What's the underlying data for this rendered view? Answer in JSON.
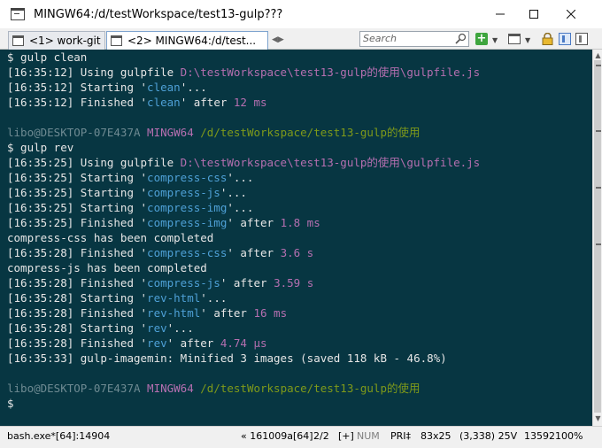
{
  "window": {
    "title": "MINGW64:/d/testWorkspace/test13-gulp???"
  },
  "tabs": [
    {
      "label": "<1> work-git"
    },
    {
      "label": "<2>  MINGW64:/d/test..."
    }
  ],
  "search": {
    "placeholder": "Search"
  },
  "toolbar": {
    "add_label": "+"
  },
  "console": {
    "lines": [
      [
        {
          "t": "$ gulp clean",
          "c": "w"
        }
      ],
      [
        {
          "t": "[16:35:12] Using gulpfile ",
          "c": "w"
        },
        {
          "t": "D:\\testWorkspace\\test13-gulp的使用\\gulpfile.js",
          "c": "p"
        }
      ],
      [
        {
          "t": "[16:35:12] Starting '",
          "c": "w"
        },
        {
          "t": "clean",
          "c": "b"
        },
        {
          "t": "'...",
          "c": "w"
        }
      ],
      [
        {
          "t": "[16:35:12] Finished '",
          "c": "w"
        },
        {
          "t": "clean",
          "c": "b"
        },
        {
          "t": "' after ",
          "c": "w"
        },
        {
          "t": "12 ms",
          "c": "p"
        }
      ],
      [],
      [
        {
          "t": "libo@DESKTOP-07E437A ",
          "c": "gr"
        },
        {
          "t": "MINGW64 ",
          "c": "p"
        },
        {
          "t": "/d/testWorkspace/test13-gulp的使用",
          "c": "g"
        }
      ],
      [
        {
          "t": "$ gulp rev",
          "c": "w"
        }
      ],
      [
        {
          "t": "[16:35:25] Using gulpfile ",
          "c": "w"
        },
        {
          "t": "D:\\testWorkspace\\test13-gulp的使用\\gulpfile.js",
          "c": "p"
        }
      ],
      [
        {
          "t": "[16:35:25] Starting '",
          "c": "w"
        },
        {
          "t": "compress-css",
          "c": "b"
        },
        {
          "t": "'...",
          "c": "w"
        }
      ],
      [
        {
          "t": "[16:35:25] Starting '",
          "c": "w"
        },
        {
          "t": "compress-js",
          "c": "b"
        },
        {
          "t": "'...",
          "c": "w"
        }
      ],
      [
        {
          "t": "[16:35:25] Starting '",
          "c": "w"
        },
        {
          "t": "compress-img",
          "c": "b"
        },
        {
          "t": "'...",
          "c": "w"
        }
      ],
      [
        {
          "t": "[16:35:25] Finished '",
          "c": "w"
        },
        {
          "t": "compress-img",
          "c": "b"
        },
        {
          "t": "' after ",
          "c": "w"
        },
        {
          "t": "1.8 ms",
          "c": "p"
        }
      ],
      [
        {
          "t": "compress-css has been completed",
          "c": "w"
        }
      ],
      [
        {
          "t": "[16:35:28] Finished '",
          "c": "w"
        },
        {
          "t": "compress-css",
          "c": "b"
        },
        {
          "t": "' after ",
          "c": "w"
        },
        {
          "t": "3.6 s",
          "c": "p"
        }
      ],
      [
        {
          "t": "compress-js has been completed",
          "c": "w"
        }
      ],
      [
        {
          "t": "[16:35:28] Finished '",
          "c": "w"
        },
        {
          "t": "compress-js",
          "c": "b"
        },
        {
          "t": "' after ",
          "c": "w"
        },
        {
          "t": "3.59 s",
          "c": "p"
        }
      ],
      [
        {
          "t": "[16:35:28] Starting '",
          "c": "w"
        },
        {
          "t": "rev-html",
          "c": "b"
        },
        {
          "t": "'...",
          "c": "w"
        }
      ],
      [
        {
          "t": "[16:35:28] Finished '",
          "c": "w"
        },
        {
          "t": "rev-html",
          "c": "b"
        },
        {
          "t": "' after ",
          "c": "w"
        },
        {
          "t": "16 ms",
          "c": "p"
        }
      ],
      [
        {
          "t": "[16:35:28] Starting '",
          "c": "w"
        },
        {
          "t": "rev",
          "c": "b"
        },
        {
          "t": "'...",
          "c": "w"
        }
      ],
      [
        {
          "t": "[16:35:28] Finished '",
          "c": "w"
        },
        {
          "t": "rev",
          "c": "b"
        },
        {
          "t": "' after ",
          "c": "w"
        },
        {
          "t": "4.74 μs",
          "c": "p"
        }
      ],
      [
        {
          "t": "[16:35:33] gulp-imagemin: Minified 3 images ",
          "c": "w"
        },
        {
          "t": "(saved 118 kB - 46.8%)",
          "c": "w"
        }
      ],
      [],
      [
        {
          "t": "libo@DESKTOP-07E437A ",
          "c": "gr"
        },
        {
          "t": "MINGW64 ",
          "c": "p"
        },
        {
          "t": "/d/testWorkspace/test13-gulp的使用",
          "c": "g"
        }
      ],
      [
        {
          "t": "$",
          "c": "w"
        }
      ]
    ]
  },
  "statusbar": {
    "process": "bash.exe*[64]:14904",
    "build": "« 161009a[64]",
    "console_index": "2/2",
    "insert": "[+]",
    "num": "NUM",
    "pri": "PRI‡",
    "size": "83x25",
    "cursor": "(3,338) 25V",
    "pid": "13592",
    "zoom": "100%"
  },
  "colors": {
    "console_bg": "#073642",
    "text": "#e6e6e6",
    "purple": "#b56fb0",
    "blue": "#4ea0d6",
    "green": "#7f9a1a",
    "grey": "#6e8a92"
  }
}
